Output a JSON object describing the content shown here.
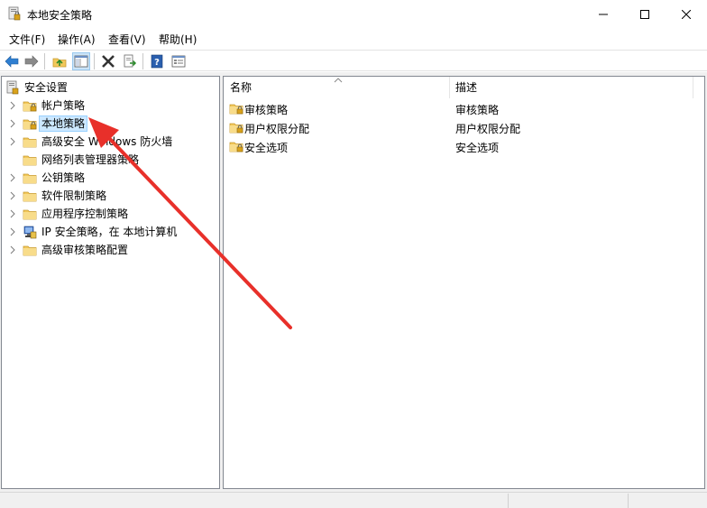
{
  "window": {
    "title": "本地安全策略",
    "controls": [
      "minimize-icon",
      "maximize-icon",
      "close-icon"
    ]
  },
  "menu": {
    "items": [
      {
        "label": "文件(F)"
      },
      {
        "label": "操作(A)"
      },
      {
        "label": "查看(V)"
      },
      {
        "label": "帮助(H)"
      }
    ]
  },
  "toolbar": {
    "buttons": [
      "back-arrow-icon",
      "forward-arrow-icon",
      "up-folder-icon",
      "show-hide-tree-icon",
      "delete-icon",
      "export-list-icon",
      "help-icon",
      "properties-icon"
    ]
  },
  "tree": {
    "root": {
      "label": "安全设置",
      "icon": "security-settings-icon"
    },
    "items": [
      {
        "label": "帐户策略",
        "icon": "policy-folder-icon",
        "expandable": true
      },
      {
        "label": "本地策略",
        "icon": "policy-folder-icon",
        "expandable": true,
        "selected": true
      },
      {
        "label": "高级安全 Windows 防火墙",
        "icon": "folder-icon",
        "expandable": true
      },
      {
        "label": "网络列表管理器策略",
        "icon": "folder-icon",
        "expandable": false
      },
      {
        "label": "公钥策略",
        "icon": "folder-icon",
        "expandable": true
      },
      {
        "label": "软件限制策略",
        "icon": "folder-icon",
        "expandable": true
      },
      {
        "label": "应用程序控制策略",
        "icon": "folder-icon",
        "expandable": true
      },
      {
        "label": "IP 安全策略，在 本地计算机",
        "icon": "ip-security-icon",
        "expandable": true
      },
      {
        "label": "高级审核策略配置",
        "icon": "folder-icon",
        "expandable": true
      }
    ]
  },
  "list": {
    "columns": {
      "name": "名称",
      "description": "描述"
    },
    "rows": [
      {
        "name": "审核策略",
        "description": "审核策略",
        "icon": "policy-folder-icon"
      },
      {
        "name": "用户权限分配",
        "description": "用户权限分配",
        "icon": "policy-folder-icon"
      },
      {
        "name": "安全选项",
        "description": "安全选项",
        "icon": "policy-folder-icon"
      }
    ]
  },
  "colors": {
    "selection_bg": "#cce8ff",
    "annotation_arrow": "#e8302a",
    "folder": "#f5d27a"
  }
}
